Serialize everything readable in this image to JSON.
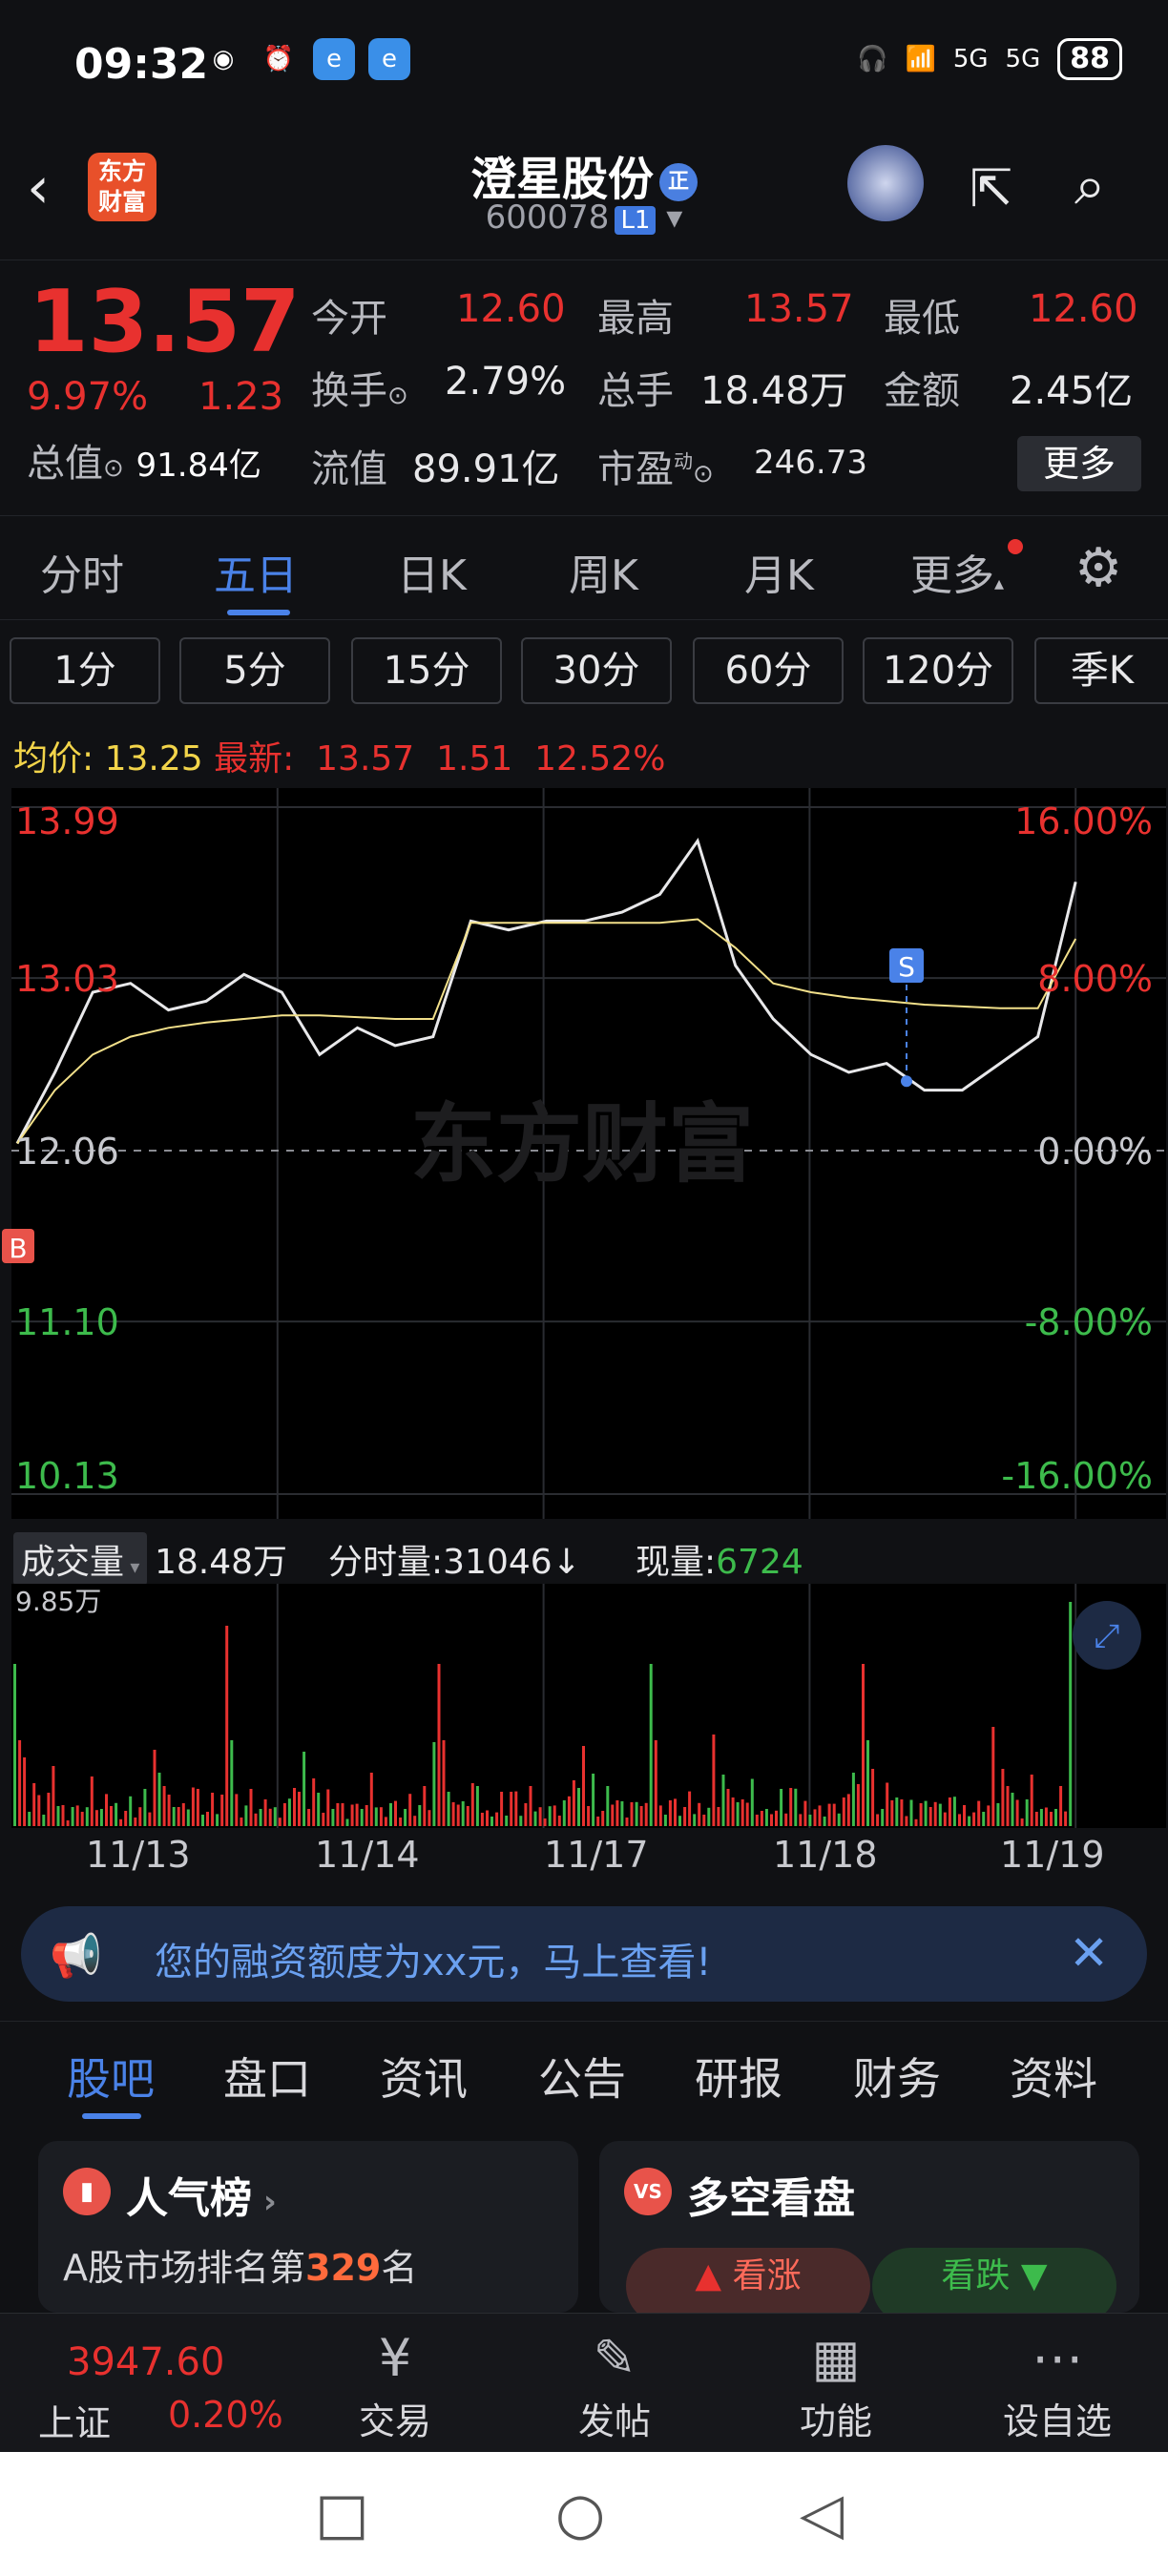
{
  "status": {
    "time": "09:32",
    "battery": "88",
    "net1": "5G",
    "net2": "5G"
  },
  "header": {
    "logo": "东方财富",
    "name": "澄星股份",
    "badge": "正",
    "code": "600078",
    "level": "L1"
  },
  "quote": {
    "price": "13.57",
    "pct": "9.97%",
    "change": "1.23",
    "open_label": "今开",
    "open": "12.60",
    "high_label": "最高",
    "high": "13.57",
    "low_label": "最低",
    "low": "12.60",
    "turnover_label": "换手",
    "turnover": "2.79%",
    "volume_label": "总手",
    "volume": "18.48万",
    "amount_label": "金额",
    "amount": "2.45亿",
    "mktcap_label": "总值",
    "mktcap": "91.84亿",
    "float_label": "流值",
    "float": "89.91亿",
    "pe_label": "市盈",
    "pe_sup": "动",
    "pe": "246.73",
    "more": "更多"
  },
  "tabs": [
    "分时",
    "五日",
    "日K",
    "周K",
    "月K",
    "更多"
  ],
  "periods": [
    "1分",
    "5分",
    "15分",
    "30分",
    "60分",
    "120分",
    "季K"
  ],
  "avg_bar": {
    "avg_label": "均价:",
    "avg": "13.25",
    "latest_label": "最新:",
    "latest": "13.57",
    "change": "1.51",
    "pct": "12.52%"
  },
  "chart_data": {
    "type": "line",
    "x": [
      "11/13",
      "11/14",
      "11/17",
      "11/18",
      "11/19"
    ],
    "y_left_ticks": [
      "13.99",
      "13.03",
      "12.06",
      "11.10",
      "10.13"
    ],
    "y_right_ticks": [
      "16.00%",
      "8.00%",
      "0.00%",
      "-8.00%",
      "-16.00%"
    ],
    "baseline": "12.06",
    "watermark": "东方财富",
    "markers": {
      "buy": "B",
      "sell": "S"
    },
    "series": [
      {
        "values": [
          12.1,
          12.5,
          12.95,
          13.0,
          12.85,
          12.9,
          13.05,
          12.95,
          12.6,
          12.75,
          12.65,
          12.7,
          13.35,
          13.3,
          13.35,
          13.35,
          13.4,
          13.5,
          13.8,
          13.1,
          12.8,
          12.6,
          12.5,
          12.55,
          12.4,
          12.4,
          12.55,
          12.7,
          13.57
        ]
      },
      {
        "values": [
          12.1,
          12.4,
          12.6,
          12.7,
          12.75,
          12.78,
          12.8,
          12.82,
          12.82,
          12.81,
          12.8,
          12.8,
          13.34,
          13.34,
          13.34,
          13.34,
          13.34,
          13.34,
          13.36,
          13.2,
          13.0,
          12.95,
          12.92,
          12.9,
          12.88,
          12.87,
          12.86,
          12.86,
          13.25
        ]
      }
    ],
    "volume": {
      "label": "成交量",
      "total": "18.48万",
      "tick_label": "分时量:",
      "tick_value": "31046",
      "tick_arrow": "↓",
      "now_label": "现量:",
      "now_value": "6724",
      "y_max": "9.85万"
    }
  },
  "promo": "您的融资额度为xx元，马上查看!",
  "lower_tabs": [
    "股吧",
    "盘口",
    "资讯",
    "公告",
    "研报",
    "财务",
    "资料"
  ],
  "cards": {
    "popularity": {
      "title": "人气榜",
      "sub_prefix": "A股市场排名第",
      "rank": "329",
      "sub_suffix": "名"
    },
    "bullbear": {
      "title": "多空看盘",
      "bull": "看涨",
      "bear": "看跌"
    }
  },
  "bottom": {
    "index_value": "3947.60",
    "index_name": "上证",
    "index_pct": "0.20%",
    "items": [
      "交易",
      "发帖",
      "功能",
      "设自选"
    ]
  }
}
